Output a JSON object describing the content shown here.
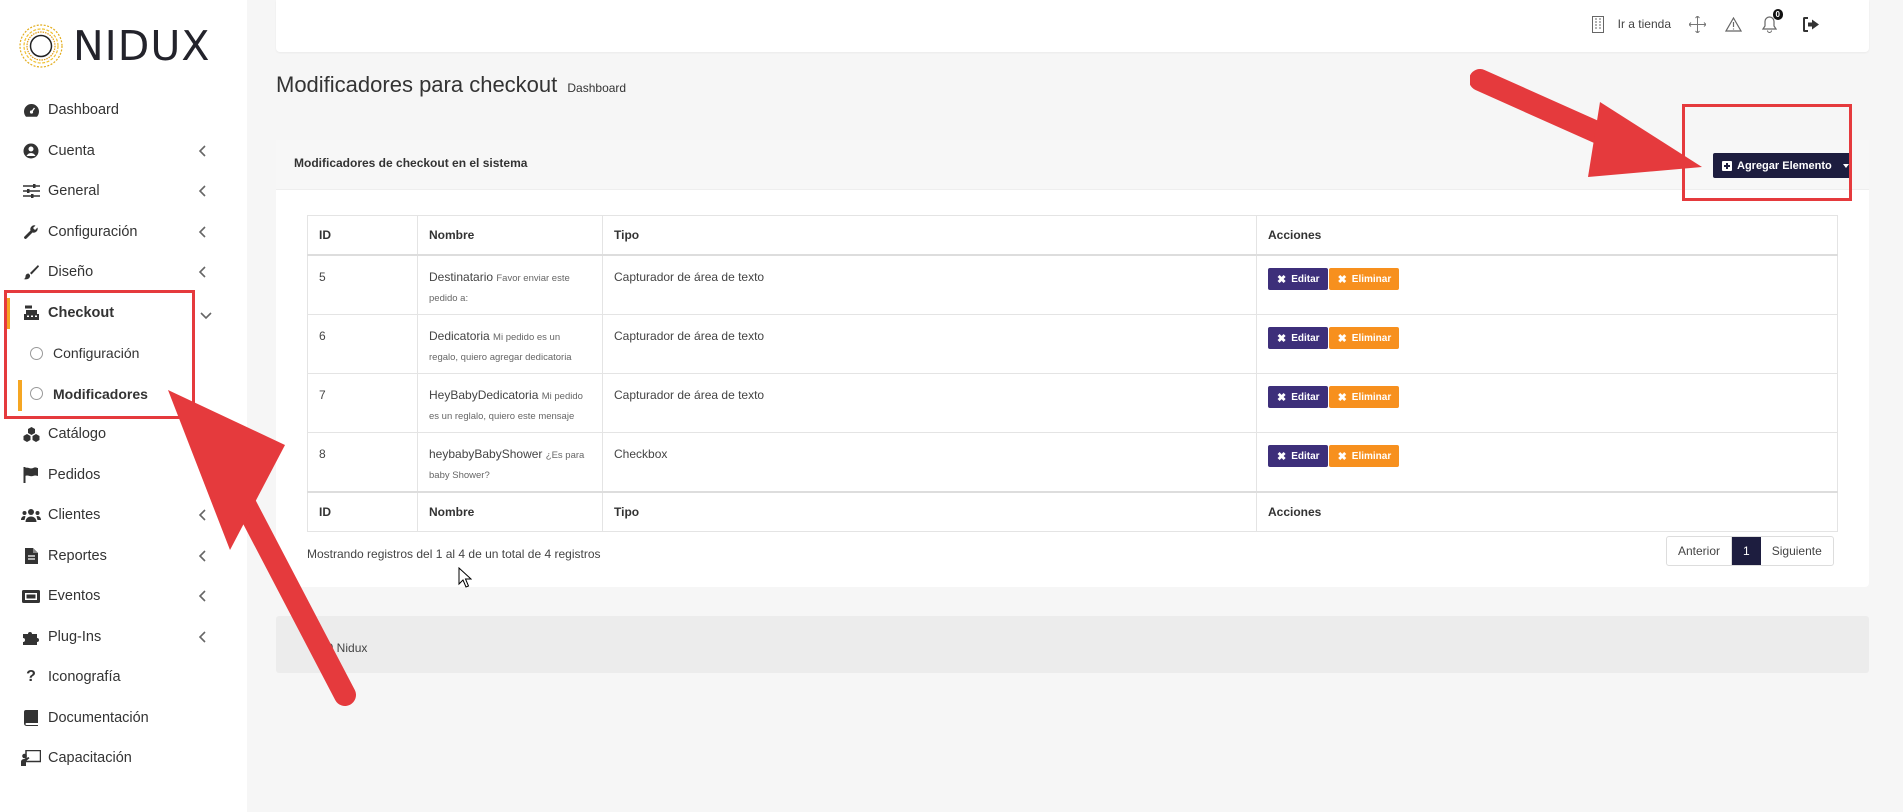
{
  "brand": {
    "name": "NIDUX"
  },
  "sidebar": {
    "items": [
      {
        "label": "Dashboard",
        "icon": "gauge-icon",
        "chevron": false
      },
      {
        "label": "Cuenta",
        "icon": "user-circle-icon",
        "chevron": true
      },
      {
        "label": "General",
        "icon": "sliders-icon",
        "chevron": true
      },
      {
        "label": "Configuración",
        "icon": "wrench-icon",
        "chevron": true
      },
      {
        "label": "Diseño",
        "icon": "brush-icon",
        "chevron": true
      },
      {
        "label": "Checkout",
        "icon": "cash-register-icon",
        "chevron": true
      },
      {
        "label": "Catálogo",
        "icon": "cubes-icon",
        "chevron": false
      },
      {
        "label": "Pedidos",
        "icon": "flag-icon",
        "chevron": false
      },
      {
        "label": "Clientes",
        "icon": "users-icon",
        "chevron": true
      },
      {
        "label": "Reportes",
        "icon": "file-icon",
        "chevron": true
      },
      {
        "label": "Eventos",
        "icon": "ticket-icon",
        "chevron": true
      },
      {
        "label": "Plug-Ins",
        "icon": "puzzle-icon",
        "chevron": true
      },
      {
        "label": "Iconografía",
        "icon": "question-icon",
        "chevron": false
      },
      {
        "label": "Documentación",
        "icon": "book-icon",
        "chevron": false
      },
      {
        "label": "Capacitación",
        "icon": "chalkboard-icon",
        "chevron": false
      }
    ],
    "checkout_sub": [
      {
        "label": "Configuración"
      },
      {
        "label": "Modificadores"
      }
    ]
  },
  "topbar": {
    "store_link": "Ir a tienda",
    "notifications_count": "0"
  },
  "page": {
    "title": "Modificadores para checkout",
    "breadcrumb": "Dashboard"
  },
  "card": {
    "title": "Modificadores de checkout en el sistema",
    "add_button": "Agregar Elemento"
  },
  "table": {
    "headers": [
      "ID",
      "Nombre",
      "Tipo",
      "Acciones"
    ],
    "rows": [
      {
        "id": "5",
        "name": "Destinatario",
        "desc": "Favor enviar este pedido a:",
        "tipo": "Capturador de área de texto"
      },
      {
        "id": "6",
        "name": "Dedicatoria",
        "desc": "Mi pedido es un regalo, quiero agregar dedicatoria",
        "tipo": "Capturador de área de texto"
      },
      {
        "id": "7",
        "name": "HeyBabyDedicatoria",
        "desc": "Mi pedido es un reglalo, quiero este mensaje",
        "tipo": "Capturador de área de texto"
      },
      {
        "id": "8",
        "name": "heybabyBabyShower",
        "desc": "¿Es para baby Shower?",
        "tipo": "Checkbox"
      }
    ],
    "edit_label": "Editar",
    "delete_label": "Eliminar"
  },
  "table_info": "Mostrando registros del 1 al 4 de un total de 4 registros",
  "pagination": {
    "prev": "Anterior",
    "current": "1",
    "next": "Siguiente"
  },
  "footer": {
    "text": "20 Nidux"
  },
  "colors": {
    "accent": "#f5a623",
    "primary": "#1d1d3f",
    "edit": "#3d2f7a",
    "delete": "#f7901e",
    "annotation": "#e53a3d"
  }
}
